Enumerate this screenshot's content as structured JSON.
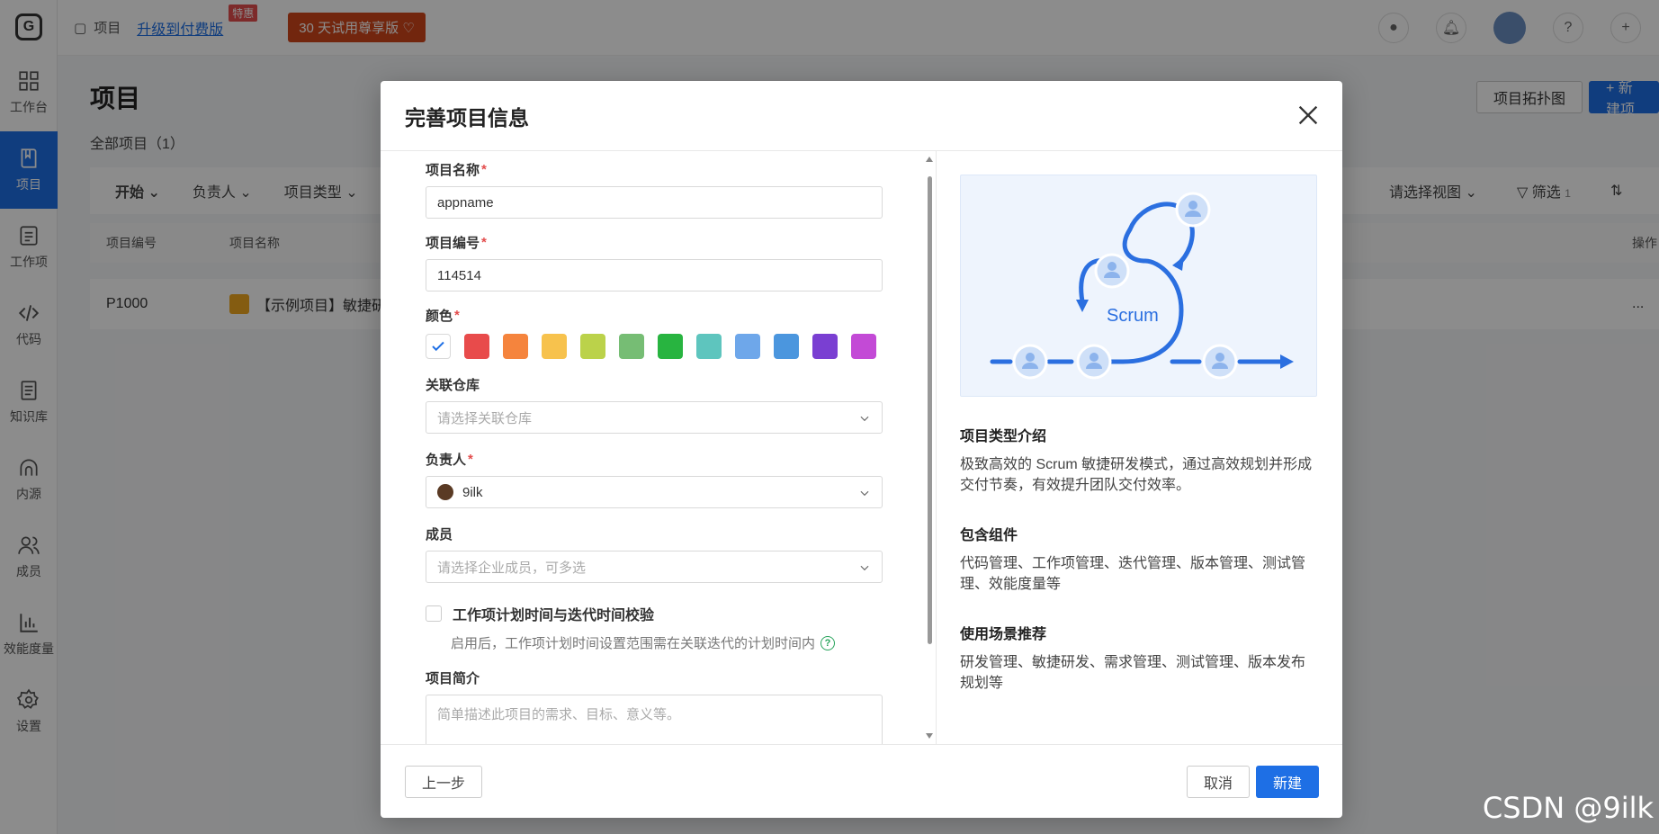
{
  "topbar": {
    "breadcrumb": "项目",
    "upgrade_label": "升级到付费版",
    "hot_tag": "特惠",
    "trial_label": "30 天试用尊享版 ♡",
    "help": "?",
    "add": "+"
  },
  "sidebar": {
    "items": [
      {
        "label": "工作台",
        "icon": "dashboard-icon"
      },
      {
        "label": "项目",
        "icon": "book-icon"
      },
      {
        "label": "工作项",
        "icon": "task-icon"
      },
      {
        "label": "代码",
        "icon": "code-icon"
      },
      {
        "label": "知识库",
        "icon": "doc-icon"
      },
      {
        "label": "内源",
        "icon": "source-icon"
      },
      {
        "label": "成员",
        "icon": "members-icon"
      },
      {
        "label": "效能度量",
        "icon": "chart-icon"
      },
      {
        "label": "设置",
        "icon": "gear-icon"
      }
    ]
  },
  "page": {
    "title": "项目",
    "subtitle": "全部项目（1）",
    "topology_btn": "项目拓扑图",
    "new_btn": "+ 新建项",
    "filters": [
      "开始",
      "负责人",
      "项目类型"
    ],
    "view_select": "请选择视图",
    "filter_btn": "筛选",
    "filter_count": "1",
    "col_id": "项目编号",
    "col_name": "项目名称",
    "col_ops": "操作",
    "row_id": "P1000",
    "row_name": "【示例项目】敏捷研",
    "row_more": "..."
  },
  "modal": {
    "title": "完善项目信息",
    "name_label": "项目名称",
    "name_value": "appname",
    "code_label": "项目编号",
    "code_value": "114514",
    "color_label": "颜色",
    "colors": [
      "#e84b4b",
      "#f5843d",
      "#f7c24d",
      "#bbd24a",
      "#76bd74",
      "#28b440",
      "#5ec5be",
      "#6ea7ea",
      "#4b96de",
      "#7a3fd2",
      "#c34ad6"
    ],
    "repo_label": "关联仓库",
    "repo_placeholder": "请选择关联仓库",
    "owner_label": "负责人",
    "owner_value": "9ilk",
    "members_label": "成员",
    "members_placeholder": "请选择企业成员，可多选",
    "check_label": "工作项计划时间与迭代时间校验",
    "check_hint": "启用后，工作项计划时间设置范围需在关联迭代的计划时间内",
    "desc_label": "项目简介",
    "desc_placeholder": "简单描述此项目的需求、目标、意义等。",
    "illus_label": "Scrum",
    "intro_title": "项目类型介绍",
    "intro_text": "极致高效的 Scrum 敏捷研发模式，通过高效规划并形成交付节奏，有效提升团队交付效率。",
    "components_title": "包含组件",
    "components_text": "代码管理、工作项管理、迭代管理、版本管理、测试管理、效能度量等",
    "scenario_title": "使用场景推荐",
    "scenario_text": "研发管理、敏捷研发、需求管理、测试管理、版本发布规划等",
    "prev_btn": "上一步",
    "cancel_btn": "取消",
    "create_btn": "新建"
  },
  "watermark": "CSDN @9ilk"
}
